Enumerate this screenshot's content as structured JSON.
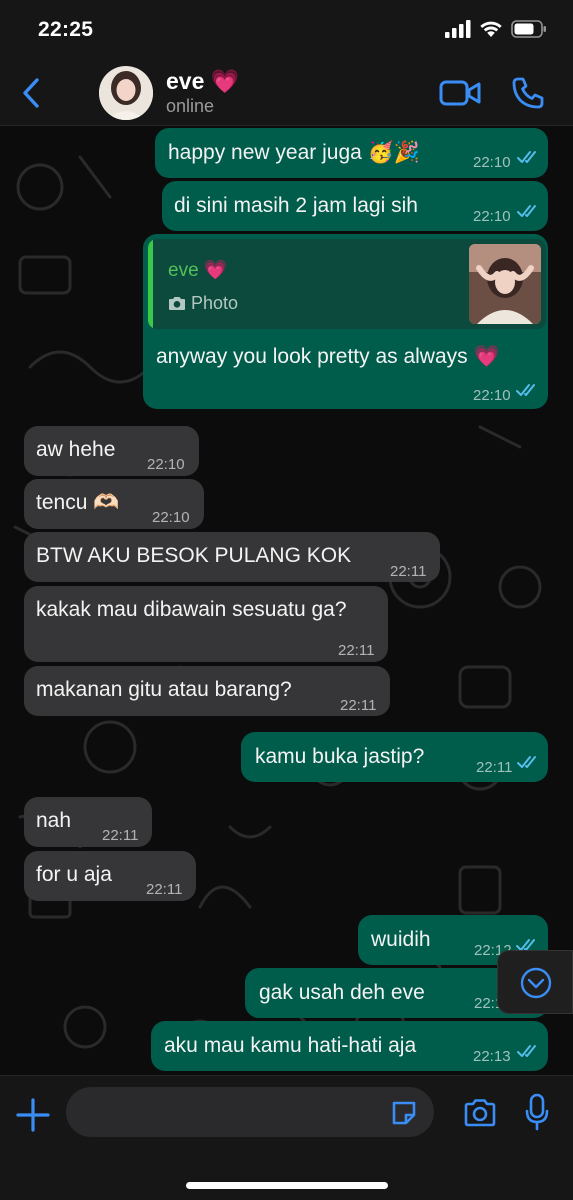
{
  "status_bar": {
    "time": "22:25"
  },
  "header": {
    "contact_name": "eve 💗",
    "contact_status": "online"
  },
  "messages": [
    {
      "text": "happy new year juga 🥳🎉",
      "time": "22:10"
    },
    {
      "text": "di sini masih 2 jam lagi sih",
      "time": "22:10"
    },
    {
      "text": "anyway you look pretty as always 💗",
      "time": "22:10",
      "quote_name": "eve 💗",
      "quote_type": "Photo"
    },
    {
      "text": "aw hehe",
      "time": "22:10"
    },
    {
      "text": "tencu 🫶🏻",
      "time": "22:10"
    },
    {
      "text": "BTW AKU BESOK PULANG KOK",
      "time": "22:11"
    },
    {
      "text": "kakak mau dibawain sesuatu ga?",
      "time": "22:11"
    },
    {
      "text": "makanan gitu atau barang?",
      "time": "22:11"
    },
    {
      "text": "kamu buka jastip?",
      "time": "22:11"
    },
    {
      "text": "nah",
      "time": "22:11"
    },
    {
      "text": "for u aja",
      "time": "22:11"
    },
    {
      "text": "wuidih",
      "time": "22:12"
    },
    {
      "text": "gak usah deh eve",
      "time": "22:1"
    },
    {
      "text": "aku mau kamu hati-hati aja",
      "time": "22:13"
    }
  ],
  "colors": {
    "outgoing_bubble": "#005c4b",
    "incoming_bubble": "#363638",
    "accent_blue": "#3a8df5",
    "read_ticks": "#53bdeb",
    "quote_name": "#52c05a"
  },
  "input": {
    "message_value": ""
  },
  "icons": [
    "back-arrow-icon",
    "video-call-icon",
    "phone-call-icon",
    "camera-icon",
    "plus-icon",
    "sticker-icon",
    "mic-icon",
    "chevron-down-icon"
  ]
}
